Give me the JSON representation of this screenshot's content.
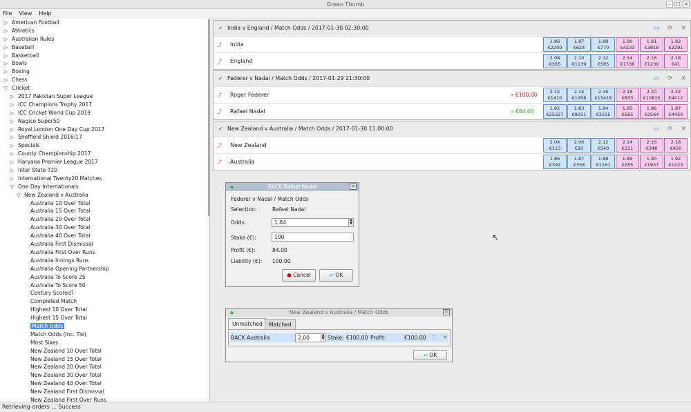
{
  "window": {
    "title": "Green Thumb"
  },
  "menu": [
    "File",
    "View",
    "Help"
  ],
  "tree": [
    {
      "label": "American Football",
      "indent": 0,
      "toggle": "▷"
    },
    {
      "label": "Athletics",
      "indent": 0,
      "toggle": "▷"
    },
    {
      "label": "Australian Rules",
      "indent": 0,
      "toggle": "▷"
    },
    {
      "label": "Baseball",
      "indent": 0,
      "toggle": "▷"
    },
    {
      "label": "Basketball",
      "indent": 0,
      "toggle": "▷"
    },
    {
      "label": "Bowls",
      "indent": 0,
      "toggle": "▷"
    },
    {
      "label": "Boxing",
      "indent": 0,
      "toggle": "▷"
    },
    {
      "label": "Chess",
      "indent": 0,
      "toggle": "▷"
    },
    {
      "label": "Cricket",
      "indent": 0,
      "toggle": "▽"
    },
    {
      "label": "2017 Pakistan Super League",
      "indent": 1,
      "toggle": "▷"
    },
    {
      "label": "ICC Champions Trophy 2017",
      "indent": 1,
      "toggle": "▷"
    },
    {
      "label": "ICC Cricket World Cup 2019",
      "indent": 1,
      "toggle": "▷"
    },
    {
      "label": "Nagico Super50",
      "indent": 1,
      "toggle": "▷"
    },
    {
      "label": "Royal London One Day Cup 2017",
      "indent": 1,
      "toggle": "▷"
    },
    {
      "label": "Sheffield Shield 2016/17",
      "indent": 1,
      "toggle": "▷"
    },
    {
      "label": "Specials",
      "indent": 1,
      "toggle": "▷"
    },
    {
      "label": "County Championship 2017",
      "indent": 1,
      "toggle": "▷"
    },
    {
      "label": "Haryana Premier League 2017",
      "indent": 1,
      "toggle": "▷"
    },
    {
      "label": "Inter State T20",
      "indent": 1,
      "toggle": "▷"
    },
    {
      "label": "International Twenty20 Matches",
      "indent": 1,
      "toggle": "▷"
    },
    {
      "label": "One Day Internationals",
      "indent": 1,
      "toggle": "▽"
    },
    {
      "label": "New Zealand v Australia",
      "indent": 2,
      "toggle": "▽"
    },
    {
      "label": "Australia 10 Over Total",
      "indent": 3,
      "toggle": ""
    },
    {
      "label": "Australia 15 Over Total",
      "indent": 3,
      "toggle": ""
    },
    {
      "label": "Australia 20 Over Total",
      "indent": 3,
      "toggle": ""
    },
    {
      "label": "Australia 30 Over Total",
      "indent": 3,
      "toggle": ""
    },
    {
      "label": "Australia 40 Over Total",
      "indent": 3,
      "toggle": ""
    },
    {
      "label": "Australia First Dismissal",
      "indent": 3,
      "toggle": ""
    },
    {
      "label": "Australia First Over Runs",
      "indent": 3,
      "toggle": ""
    },
    {
      "label": "Australia Innings Runs",
      "indent": 3,
      "toggle": ""
    },
    {
      "label": "Australia Opening Partnership",
      "indent": 3,
      "toggle": ""
    },
    {
      "label": "Australia To Score 25",
      "indent": 3,
      "toggle": ""
    },
    {
      "label": "Australia To Score 50",
      "indent": 3,
      "toggle": ""
    },
    {
      "label": "Century Scored?",
      "indent": 3,
      "toggle": ""
    },
    {
      "label": "Completed Match",
      "indent": 3,
      "toggle": ""
    },
    {
      "label": "Highest 10 Over Total",
      "indent": 3,
      "toggle": ""
    },
    {
      "label": "Highest 15 Over Total",
      "indent": 3,
      "toggle": ""
    },
    {
      "label": "Match Odds",
      "indent": 3,
      "toggle": "",
      "selected": true
    },
    {
      "label": "Match Odds (Inc. Tie)",
      "indent": 3,
      "toggle": ""
    },
    {
      "label": "Most Sixes",
      "indent": 3,
      "toggle": ""
    },
    {
      "label": "New Zealand 10 Over Total",
      "indent": 3,
      "toggle": ""
    },
    {
      "label": "New Zealand 15 Over Total",
      "indent": 3,
      "toggle": ""
    },
    {
      "label": "New Zealand 20 Over Total",
      "indent": 3,
      "toggle": ""
    },
    {
      "label": "New Zealand 30 Over Total",
      "indent": 3,
      "toggle": ""
    },
    {
      "label": "New Zealand 40 Over Total",
      "indent": 3,
      "toggle": ""
    },
    {
      "label": "New Zealand First Dismissal",
      "indent": 3,
      "toggle": ""
    },
    {
      "label": "New Zealand First Over Runs",
      "indent": 3,
      "toggle": ""
    }
  ],
  "markets": [
    {
      "title": "India v England / Match Odds / 2017-01-30 02:30:00",
      "runners": [
        {
          "name": "India",
          "pl": "",
          "odds": [
            [
              "1.86",
              "€2200"
            ],
            [
              "1.87",
              "€624"
            ],
            [
              "1.88",
              "€770"
            ],
            [
              "1.90",
              "€4233"
            ],
            [
              "1.91",
              "€3818"
            ],
            [
              "1.92",
              "€2291"
            ]
          ]
        },
        {
          "name": "England",
          "pl": "",
          "odds": [
            [
              "2.08",
              "€365"
            ],
            [
              "2.10",
              "€1139"
            ],
            [
              "2.12",
              "€585"
            ],
            [
              "2.14",
              "€1736"
            ],
            [
              "2.16",
              "€1239"
            ],
            [
              "2.18",
              "€41"
            ]
          ]
        }
      ]
    },
    {
      "title": "Federer v Nadal / Match Odds / 2017-01-29 21:30:00",
      "runners": [
        {
          "name": "Roger Federer",
          "pl": "» €100.00",
          "plColor": "red",
          "odds": [
            [
              "2.12",
              "€1410"
            ],
            [
              "2.14",
              "€1958"
            ],
            [
              "2.16",
              "€15418"
            ],
            [
              "2.18",
              "€833"
            ],
            [
              "2.20",
              "€10815"
            ],
            [
              "2.22",
              "€4012"
            ]
          ]
        },
        {
          "name": "Rafael Nadal",
          "pl": "» €84.00",
          "plColor": "green",
          "odds": [
            [
              "1.82",
              "€25327"
            ],
            [
              "1.83",
              "€9251"
            ],
            [
              "1.84",
              "€3155"
            ],
            [
              "1.85",
              "€565"
            ],
            [
              "1.86",
              "€2564"
            ],
            [
              "1.87",
              "€4450"
            ]
          ]
        }
      ]
    },
    {
      "title": "New Zealand v Australia / Match Odds / 2017-01-30 11:00:00",
      "runners": [
        {
          "name": "New Zealand",
          "pl": "",
          "odds": [
            [
              "2.04",
              "€113"
            ],
            [
              "2.06",
              "€20"
            ],
            [
              "2.12",
              "€540"
            ],
            [
              "2.14",
              "€311"
            ],
            [
              "2.16",
              "€348"
            ],
            [
              "2.18",
              "€450"
            ]
          ]
        },
        {
          "name": "Australia",
          "pl": "",
          "odds": [
            [
              "1.86",
              "€392"
            ],
            [
              "1.87",
              "€358"
            ],
            [
              "1.88",
              "€1161"
            ],
            [
              "1.89",
              "€255"
            ],
            [
              "1.90",
              "€1957"
            ],
            [
              "1.92",
              "€1223"
            ]
          ]
        }
      ]
    }
  ],
  "betDialog": {
    "title": "BACK Rafael Nadal",
    "market": "Federer v Nadal / Match Odds",
    "selectionLabel": "Selection:",
    "selection": "Rafael Nadal",
    "oddsLabel": "Odds:",
    "odds": "1.84",
    "stakeLabel": "Stake (€):",
    "stake": "100",
    "profitLabel": "Profit (€):",
    "profit": "84.00",
    "liabilityLabel": "Liability (€):",
    "liability": "100.00",
    "cancel": "Cancel",
    "ok": "OK"
  },
  "ordersDialog": {
    "title": "New Zealand v Australia / Match Odds",
    "tabs": [
      "Unmatched",
      "Matched"
    ],
    "order": {
      "selection": "BACK Australia",
      "price": "2.00",
      "stakeLabel": "Stake:",
      "stake": "€100.00",
      "profitLabel": "Profit:",
      "profit": "€100.00"
    },
    "ok": "OK"
  },
  "status": "Retrieving orders ... Success"
}
